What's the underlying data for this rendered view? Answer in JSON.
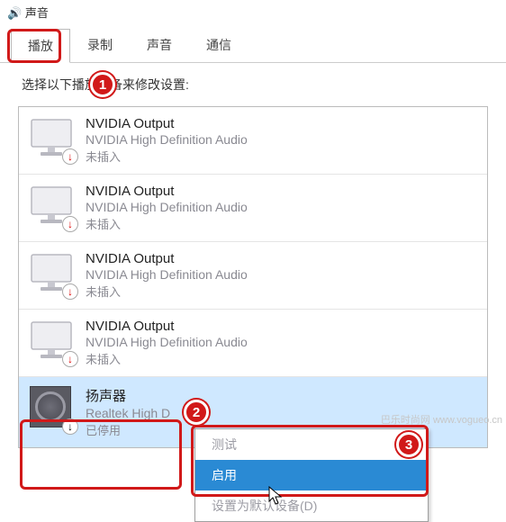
{
  "titlebar": {
    "icon_name": "sound-icon",
    "title": "声音"
  },
  "tabs": {
    "playback": "播放",
    "recording": "录制",
    "sounds": "声音",
    "communications": "通信"
  },
  "instruction": "选择以下播放设备来修改设置:",
  "devices": [
    {
      "name": "NVIDIA Output",
      "desc": "NVIDIA High Definition Audio",
      "status": "未插入",
      "status_icon": "down-arrow-red"
    },
    {
      "name": "NVIDIA Output",
      "desc": "NVIDIA High Definition Audio",
      "status": "未插入",
      "status_icon": "down-arrow-red"
    },
    {
      "name": "NVIDIA Output",
      "desc": "NVIDIA High Definition Audio",
      "status": "未插入",
      "status_icon": "down-arrow-red"
    },
    {
      "name": "NVIDIA Output",
      "desc": "NVIDIA High Definition Audio",
      "status": "未插入",
      "status_icon": "down-arrow-red"
    },
    {
      "name": "扬声器",
      "desc": "Realtek High D",
      "status": "已停用",
      "status_icon": "down-arrow-black"
    }
  ],
  "context_menu": {
    "test": "测试",
    "enable": "启用",
    "set_default": "设置为默认设备(D)"
  },
  "annotations": {
    "badge1": "1",
    "badge2": "2",
    "badge3": "3"
  },
  "watermark": "巴乐时尚网 www.vogueo.cn"
}
